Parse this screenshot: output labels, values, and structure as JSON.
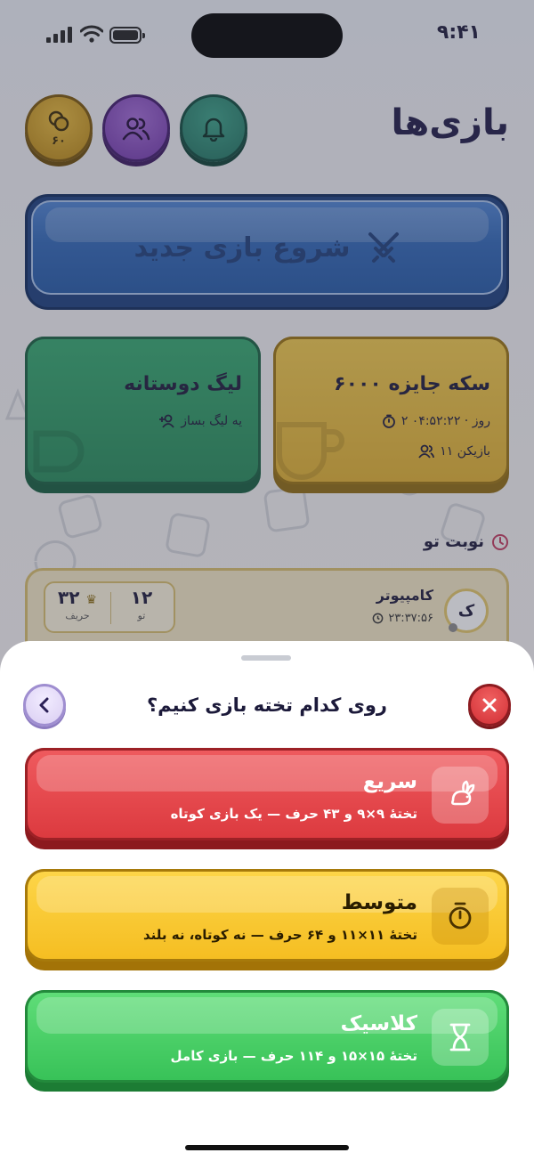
{
  "status_bar": {
    "time": "۹:۴۱"
  },
  "header": {
    "title": "بازی‌ها",
    "coins": "۶۰"
  },
  "start_button": {
    "label": "شروع بازی جدید"
  },
  "prize_card": {
    "title": "۶۰۰۰ سکه جایزه",
    "time_left": "۲ روز · ۰۴:۵۲:۲۲",
    "players": "۱۱ بازیکن"
  },
  "league_card": {
    "title": "لیگ دوستانه",
    "action": "یه لیگ بساز"
  },
  "your_turn": {
    "title": "نوبت تو",
    "game": {
      "avatar_letter": "ک",
      "opponent": "کامپیوتر",
      "time": "۲۳:۳۷:۵۶",
      "my_score": "۱۲",
      "my_label": "تو",
      "opp_score": "۳۲",
      "opp_label": "حریف"
    }
  },
  "sheet": {
    "title": "روی کدام تخته بازی کنیم؟",
    "options": [
      {
        "name": "سریع",
        "desc": "تختهٔ ۹×۹ و ۴۳ حرف — یک بازی کوتاه",
        "icon": "rabbit-icon",
        "color": "#dc3a3f"
      },
      {
        "name": "متوسط",
        "desc": "تختهٔ ۱۱×۱۱ و ۶۴ حرف — نه کوتاه، نه بلند",
        "icon": "timer-icon",
        "color": "#f5be22"
      },
      {
        "name": "کلاسیک",
        "desc": "تختهٔ ۱۵×۱۵ و ۱۱۴ حرف — بازی کامل",
        "icon": "hourglass-icon",
        "color": "#38c258"
      }
    ]
  }
}
